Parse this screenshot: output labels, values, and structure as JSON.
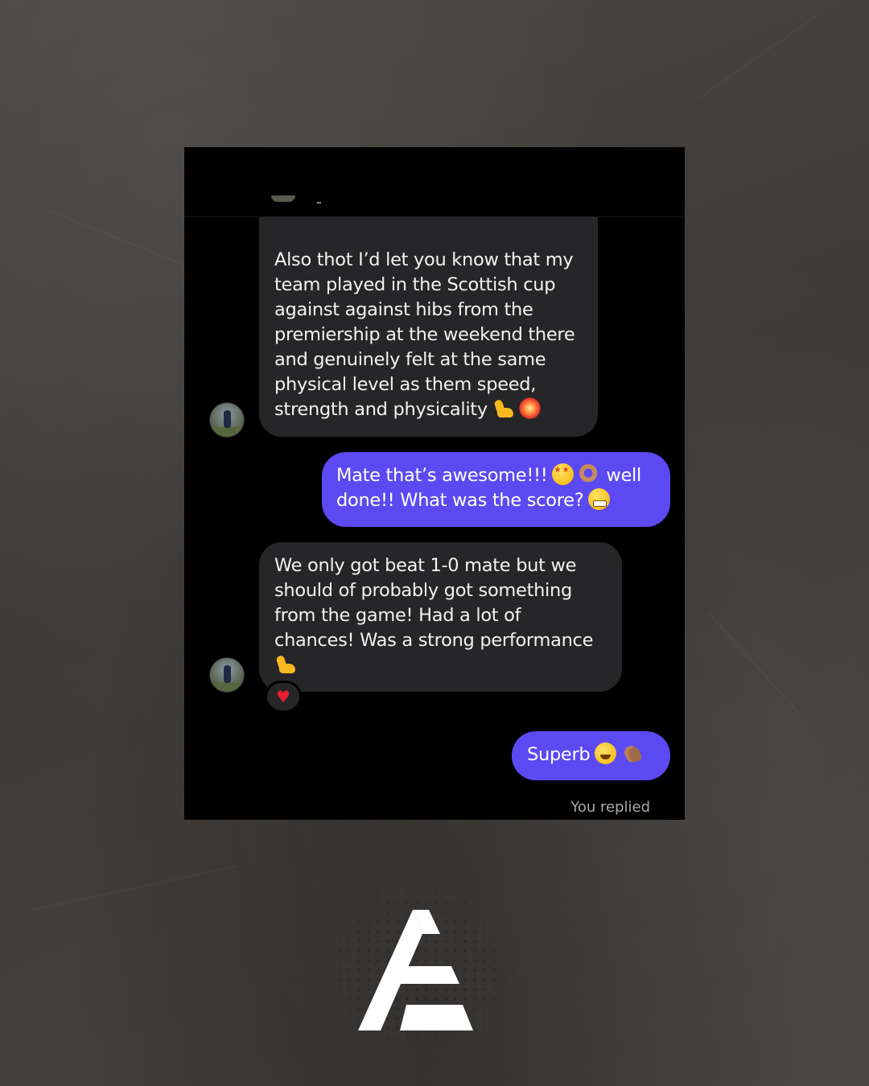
{
  "conversation": {
    "messages": [
      {
        "direction": "incoming",
        "lines": [
          "Also thot I’d let you know that my",
          "team played in the Scottish cup",
          "against against hibs from the",
          "premiership at the weekend there",
          "and genuinely felt at the same",
          "physical level as them speed,",
          "strength and physicality"
        ],
        "trailing_emoji": [
          "flexed-biceps-icon",
          "collision-icon"
        ]
      },
      {
        "direction": "outgoing",
        "line1": "Mate that’s awesome!!!",
        "line1_emoji": [
          "star-struck-icon",
          "ok-hand-icon"
        ],
        "line1_tail": "well",
        "line2": "done!! What was the score?",
        "line2_emoji": [
          "grimacing-face-icon"
        ]
      },
      {
        "direction": "incoming",
        "lines": [
          "We only got beat 1-0 mate but we",
          "should of probably got something",
          "from the game! Had a lot of",
          "chances! Was a strong performance"
        ],
        "trailing_emoji": [
          "flexed-biceps-icon"
        ],
        "reaction": "♥"
      },
      {
        "direction": "outgoing",
        "text": "Superb",
        "trailing_emoji": [
          "grinning-face-icon",
          "clapping-hands-icon"
        ]
      }
    ],
    "status": "You replied"
  },
  "colors": {
    "background": "#403d3b",
    "screen": "#000000",
    "incoming_bubble": "#262628",
    "outgoing_bubble": "#5b4af2",
    "outgoing_bubble_last": "#2f55f5",
    "reaction_heart": "#e4202d",
    "logo": "#ffffff"
  }
}
